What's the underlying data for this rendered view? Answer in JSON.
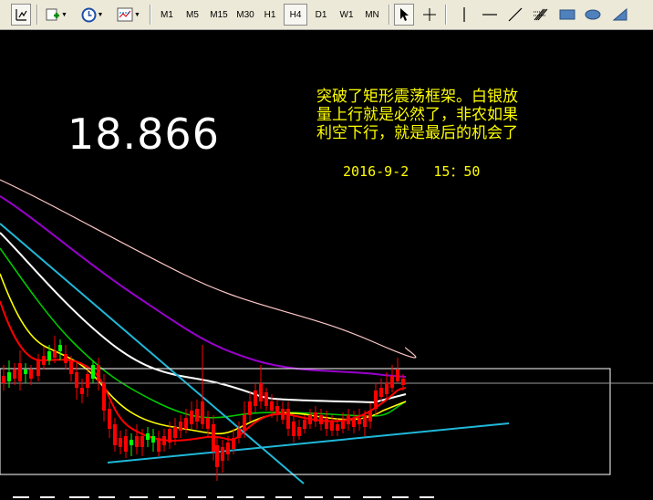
{
  "toolbar": {
    "timeframes": [
      "M1",
      "M5",
      "M15",
      "M30",
      "H1",
      "H4",
      "D1",
      "W1",
      "MN"
    ],
    "active_timeframe": "H4",
    "icons": [
      "crosshair-tool-icon",
      "new-chart-icon",
      "clock-icon",
      "indicators-icon",
      "cursor-icon",
      "crosshair-icon",
      "vertical-line-icon",
      "horizontal-line-icon",
      "trendline-icon",
      "fibonacci-icon",
      "rectangle-icon",
      "ellipse-icon",
      "triangle-icon"
    ]
  },
  "chart": {
    "price_label": "18.866",
    "annotation": "突破了矩形震荡框架。白银放\n量上行就是必然了，非农如果\n利空下行，就是最后的机会了",
    "timestamp": "2016-9-2   15：50",
    "colors": {
      "background": "#000000",
      "bull_candle": "#00ff00",
      "bear_candle": "#ff0000",
      "ma_red": "#ff0000",
      "ma_yellow": "#ffff00",
      "ma_green": "#00c800",
      "ma_white": "#ffffff",
      "ma_purple": "#9900cc",
      "ma_pink": "#ffc8c8",
      "trendlines": "#20b8d8",
      "range_box": "#ffffff",
      "annotation_text": "#ffff00"
    }
  }
}
